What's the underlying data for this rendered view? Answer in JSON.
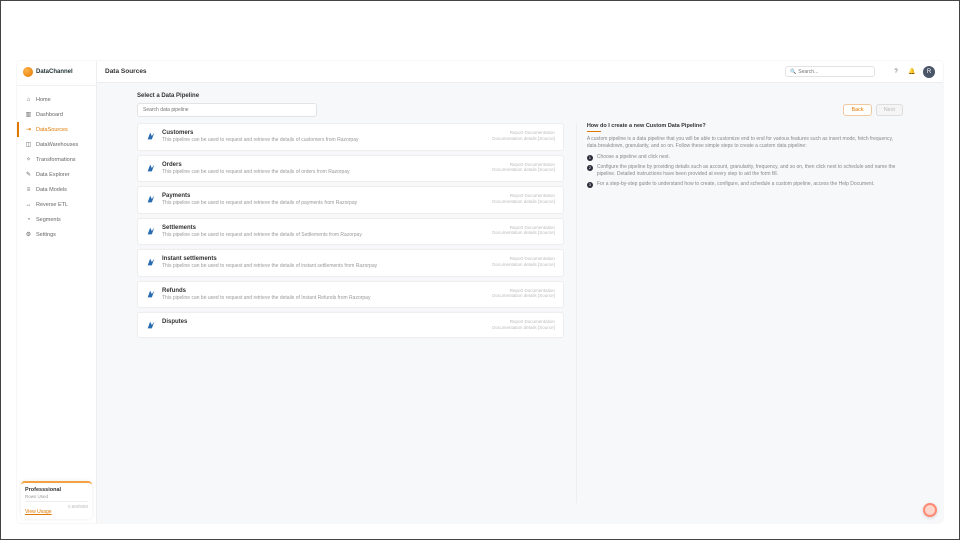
{
  "brand": {
    "name": "DataChannel"
  },
  "nav": {
    "items": [
      {
        "label": "Home",
        "icon": "⌂"
      },
      {
        "label": "Dashboard",
        "icon": "▥"
      },
      {
        "label": "DataSources",
        "icon": "⇥",
        "active": true
      },
      {
        "label": "DataWarehouses",
        "icon": "◫"
      },
      {
        "label": "Transformations",
        "icon": "✧"
      },
      {
        "label": "Data Explorer",
        "icon": "✎"
      },
      {
        "label": "Data Models",
        "icon": "≡"
      },
      {
        "label": "Reverse ETL",
        "icon": "↔"
      },
      {
        "label": "Segments",
        "icon": "◔"
      },
      {
        "label": "Settings",
        "icon": "⚙"
      }
    ]
  },
  "plan": {
    "title": "Professsional",
    "sub": "Rows Used",
    "limit": "0.5M/50M",
    "link": "View Usage"
  },
  "header": {
    "title": "Data Sources",
    "search_placeholder": "Search...",
    "avatar": "R"
  },
  "panel": {
    "title": "Select a Data Pipeline",
    "search_placeholder": "Search data pipeline",
    "back": "Back",
    "next": "Next"
  },
  "pipelines": [
    {
      "title": "Customers",
      "desc": "This pipeline can be used to request and retrieve the details of customers from Razorpay",
      "doc1": "Report Documentation",
      "doc2": "Documentation details [Source]"
    },
    {
      "title": "Orders",
      "desc": "This pipeline can be used to request and retrieve the details of orders from Razorpay",
      "doc1": "Report Documentation",
      "doc2": "Documentation details [Source]"
    },
    {
      "title": "Payments",
      "desc": "This pipeline can be used to request and retrieve the details of payments from Razorpay",
      "doc1": "Report Documentation",
      "doc2": "Documentation details [Source]"
    },
    {
      "title": "Settlements",
      "desc": "This pipeline can be used to request and retrieve the details of Settlements from Razorpay",
      "doc1": "Report Documentation",
      "doc2": "Documentation details [Source]"
    },
    {
      "title": "Instant settlements",
      "desc": "This pipeline can be used to request and retrieve the details of instant settlements from Razorpay",
      "doc1": "Report Documentation",
      "doc2": "Documentation details [Source]"
    },
    {
      "title": "Refunds",
      "desc": "This pipeline can be used to request and retrieve the details of Instant Refunds from Razorpay",
      "doc1": "Report Documentation",
      "doc2": "Documentation details [Source]"
    },
    {
      "title": "Disputes",
      "desc": "",
      "doc1": "Report Documentation",
      "doc2": "Documentation details [Source]"
    }
  ],
  "help": {
    "title": "How do I create a new Custom Data Pipeline?",
    "intro": "A custom pipeline is a data pipeline that you will be able to customize end to end for various features such as insert mode, fetch frequency, data breakdown, granularity, and so on. Follow these simple steps to create a custom data pipeline:",
    "steps": [
      "Choose a pipeline and click next.",
      "Configure the pipeline by providing details such as account, granularity, frequency, and so on, then click next to schedule and name the pipeline. Detailed instructions have been provided at every step to aid the form fill.",
      "For a step-by-step guide to understand how to create, configure, and schedule a custom pipeline, access the Help Document."
    ]
  }
}
